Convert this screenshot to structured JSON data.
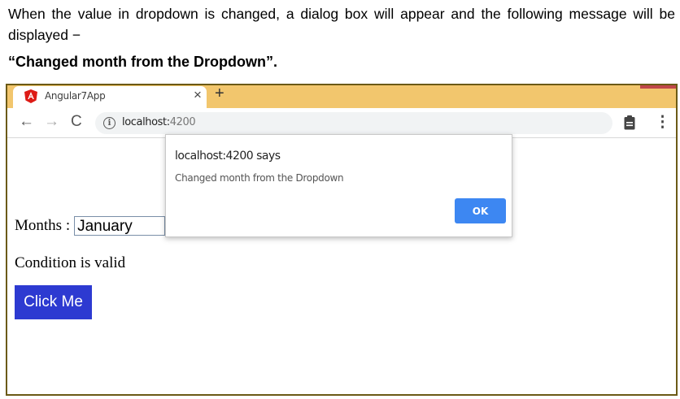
{
  "article": {
    "intro": "When the value in dropdown is changed, a dialog box will appear and the following message will be displayed −",
    "note": "“Changed month from the Dropdown”."
  },
  "browser": {
    "tab": {
      "title": "Angular7App",
      "icon": "angular-icon",
      "close": "×"
    },
    "new_tab": "+",
    "toolbar": {
      "back": "←",
      "forward": "→",
      "reload": "C",
      "info_icon": "i",
      "url_host": "localhost:",
      "url_port": "4200"
    },
    "accent_color": "#f2c66d"
  },
  "page": {
    "months_label": "Months :",
    "selected_month": "January",
    "status_text": "Condition is valid",
    "button_label": "Click Me",
    "button_color": "#2d3ad1"
  },
  "dialog": {
    "title": "localhost:4200 says",
    "message": "Changed month from the Dropdown",
    "ok_label": "OK",
    "ok_color": "#3d87f2"
  }
}
